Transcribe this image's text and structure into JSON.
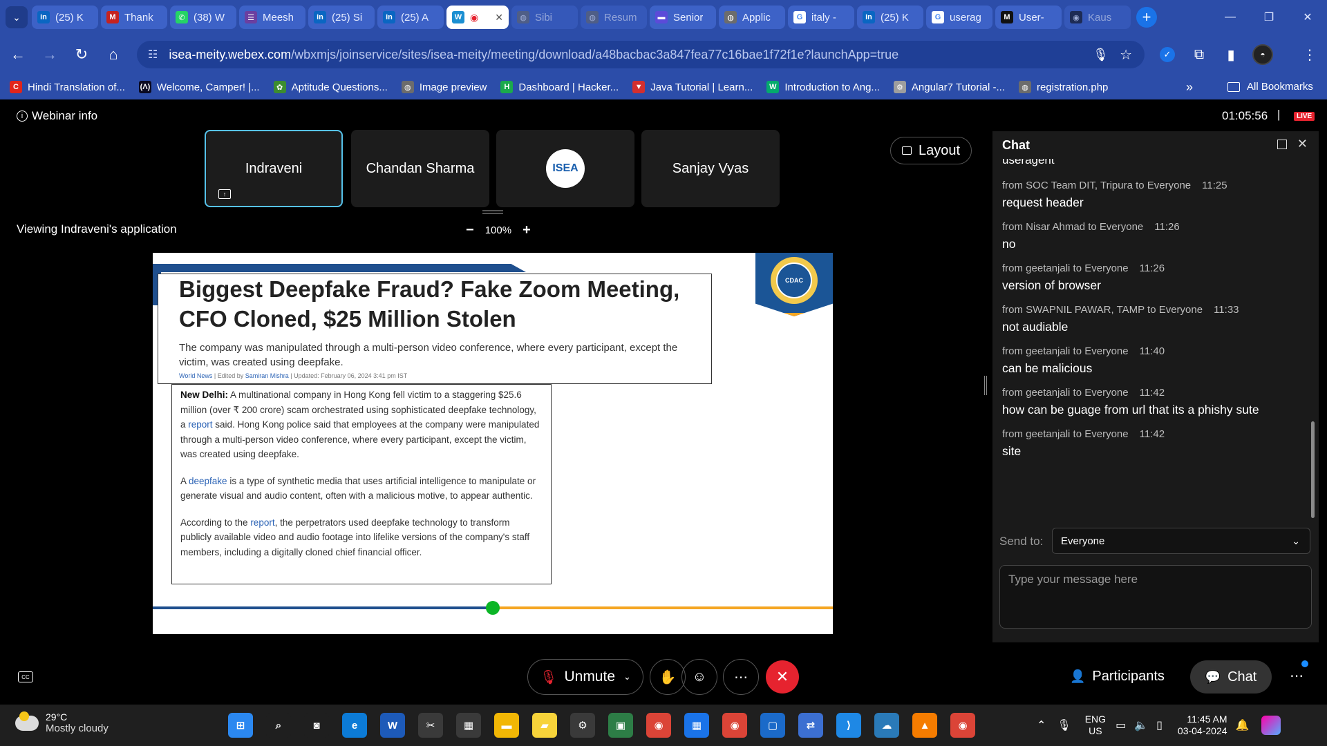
{
  "browser": {
    "tabs": [
      {
        "label": "(25) K",
        "icon": "linkedin-icon",
        "color": "#0a66c2",
        "glyph": "in"
      },
      {
        "label": "Thank",
        "icon": "gmail-icon",
        "color": "#c5221f",
        "glyph": "M"
      },
      {
        "label": "(38) W",
        "icon": "whatsapp-icon",
        "color": "#25d366",
        "glyph": "✆"
      },
      {
        "label": "Meesh",
        "icon": "forms-icon",
        "color": "#6b3fa0",
        "glyph": "☰"
      },
      {
        "label": "(25) Si",
        "icon": "linkedin-icon",
        "color": "#0a66c2",
        "glyph": "in"
      },
      {
        "label": "(25) A",
        "icon": "linkedin-icon",
        "color": "#0a66c2",
        "glyph": "in"
      },
      {
        "label": "",
        "icon": "webex-icon",
        "color": "#1b8fd2",
        "glyph": "W",
        "active": true
      },
      {
        "label": "Sibi",
        "icon": "globe-icon",
        "color": "#6c6c6c",
        "glyph": "◍",
        "dim": true
      },
      {
        "label": "Resum",
        "icon": "globe-icon",
        "color": "#6c6c6c",
        "glyph": "◍",
        "dim": true
      },
      {
        "label": "Senior",
        "icon": "job-icon",
        "color": "#5b4bd8",
        "glyph": "▬"
      },
      {
        "label": "Applic",
        "icon": "globe-icon",
        "color": "#6c6c6c",
        "glyph": "◍"
      },
      {
        "label": "italy -",
        "icon": "google-icon",
        "color": "#ffffff",
        "glyph": "G"
      },
      {
        "label": "(25) K",
        "icon": "linkedin-icon",
        "color": "#0a66c2",
        "glyph": "in"
      },
      {
        "label": "userag",
        "icon": "google-icon",
        "color": "#ffffff",
        "glyph": "G"
      },
      {
        "label": "User-",
        "icon": "medium-icon",
        "color": "#111111",
        "glyph": "M"
      },
      {
        "label": "Kaus",
        "icon": "github-icon",
        "color": "#111111",
        "glyph": "◉",
        "dim": true
      }
    ],
    "url_host": "isea-meity.webex.com",
    "url_path": "/wbxmjs/joinservice/sites/isea-meity/meeting/download/a48bacbac3a847fea77c16bae1f72f1e?launchApp=true",
    "bookmarks": [
      {
        "label": "Hindi Translation of...",
        "icon": "c-red-icon",
        "color": "#e1251b",
        "glyph": "C"
      },
      {
        "label": "Welcome, Camper! |...",
        "icon": "freecodecamp-icon",
        "color": "#0a0a23",
        "glyph": "(Λ)"
      },
      {
        "label": "Aptitude Questions...",
        "icon": "indiabix-icon",
        "color": "#3c8d2f",
        "glyph": "✿"
      },
      {
        "label": "Image preview",
        "icon": "globe-icon",
        "color": "#6c6c6c",
        "glyph": "◍"
      },
      {
        "label": "Dashboard | Hacker...",
        "icon": "hackerrank-icon",
        "color": "#1ba94c",
        "glyph": "H"
      },
      {
        "label": "Java Tutorial | Learn...",
        "icon": "javatpoint-icon",
        "color": "#d32f2f",
        "glyph": "▼"
      },
      {
        "label": "Introduction to Ang...",
        "icon": "w3schools-icon",
        "color": "#04aa6d",
        "glyph": "W"
      },
      {
        "label": "Angular7 Tutorial -...",
        "icon": "tutorialspoint-icon",
        "color": "#9e9e9e",
        "glyph": "⚙"
      },
      {
        "label": "registration.php",
        "icon": "globe-icon",
        "color": "#6c6c6c",
        "glyph": "◍"
      }
    ],
    "all_bookmarks": "All Bookmarks"
  },
  "meeting": {
    "webinar_info": "Webinar info",
    "timer": "01:05:56",
    "live": "LIVE",
    "participants": [
      "Indraveni",
      "Chandan Sharma",
      "",
      "Sanjay Vyas"
    ],
    "layout_label": "Layout",
    "viewing": "Viewing Indraveni's application",
    "zoom_minus": "−",
    "zoom_value": "100%",
    "zoom_plus": "+"
  },
  "slide": {
    "headline": "Biggest Deepfake Fraud? Fake Zoom Meeting, CFO Cloned, $25 Million Stolen",
    "subtitle": "The company was manipulated through a multi-person video conference, where every participant, except the victim, was created using deepfake.",
    "byline_section": "World News",
    "byline_sep1": " | Edited by ",
    "byline_author": "Samiran Mishra",
    "byline_sep2": " | Updated: February 06, 2024 3:41 pm IST",
    "p1_lead": "New Delhi:",
    "p1_a": " A multinational company in Hong Kong fell victim to a staggering  $25.6 million (over ₹ 200 crore) scam orchestrated using sophisticated deepfake technology, a ",
    "p1_link": "report",
    "p1_b": " said. Hong Kong police said that employees at the company were manipulated through a multi-person video conference, where every participant, except the victim, was created using deepfake.",
    "p2_a": "A ",
    "p2_link": "deepfake",
    "p2_b": " is a type of synthetic media that uses artificial intelligence to manipulate or generate visual and audio content, often with a malicious motive, to appear authentic.",
    "p3_a": "According to the ",
    "p3_link": "report",
    "p3_b": ", the perpetrators used deepfake technology to transform publicly available video and audio footage into lifelike versions of the company's staff members, including a digitally cloned chief financial officer.",
    "progress_fraction": 0.5
  },
  "chat": {
    "title": "Chat",
    "first_message": "useragent",
    "messages": [
      {
        "from": "from SOC Team DIT, Tripura to Everyone",
        "time": "11:25",
        "text": "request header"
      },
      {
        "from": "from Nisar Ahmad to Everyone",
        "time": "11:26",
        "text": "no"
      },
      {
        "from": "from geetanjali to Everyone",
        "time": "11:26",
        "text": "version of browser"
      },
      {
        "from": "from SWAPNIL PAWAR, TAMP to Everyone",
        "time": "11:33",
        "text": "not audiable"
      },
      {
        "from": "from geetanjali to Everyone",
        "time": "11:40",
        "text": "can be malicious"
      },
      {
        "from": "from geetanjali to Everyone",
        "time": "11:42",
        "text": "how can be guage from url that its a phishy sute"
      },
      {
        "from": "from geetanjali to Everyone",
        "time": "11:42",
        "text": "site"
      }
    ],
    "send_to_label": "Send to:",
    "send_to_value": "Everyone",
    "input_placeholder": "Type your message here"
  },
  "controls": {
    "unmute": "Unmute",
    "participants": "Participants",
    "chat": "Chat"
  },
  "taskbar": {
    "temperature": "29°C",
    "weather": "Mostly cloudy",
    "lang_1": "ENG",
    "lang_2": "US",
    "time": "11:45 AM",
    "date": "03-04-2024",
    "apps": [
      {
        "icon": "windows-start-icon",
        "color": "#2b88f0",
        "glyph": "⊞"
      },
      {
        "icon": "search-icon",
        "color": "#1f1f1f",
        "glyph": "⌕"
      },
      {
        "icon": "camera-icon",
        "color": "#1f1f1f",
        "glyph": "◙"
      },
      {
        "icon": "edge-icon",
        "color": "#0c7bd6",
        "glyph": "e"
      },
      {
        "icon": "word-icon",
        "color": "#1d5ab8",
        "glyph": "W"
      },
      {
        "icon": "snipping-tool-icon",
        "color": "#3a3a3a",
        "glyph": "✂"
      },
      {
        "icon": "ms-store-icon",
        "color": "#3a3a3a",
        "glyph": "▦"
      },
      {
        "icon": "file-explorer-icon",
        "color": "#f2b705",
        "glyph": "▬"
      },
      {
        "icon": "sticky-notes-icon",
        "color": "#f7d33a",
        "glyph": "▰"
      },
      {
        "icon": "settings-icon",
        "color": "#3a3a3a",
        "glyph": "⚙"
      },
      {
        "icon": "photos-icon",
        "color": "#2d7d46",
        "glyph": "▣"
      },
      {
        "icon": "chrome-icon",
        "color": "#db4437",
        "glyph": "◉"
      },
      {
        "icon": "calendar-icon",
        "color": "#1a73e8",
        "glyph": "▦"
      },
      {
        "icon": "chrome-icon",
        "color": "#db4437",
        "glyph": "◉"
      },
      {
        "icon": "virtualbox-icon",
        "color": "#1b6ac9",
        "glyph": "▢"
      },
      {
        "icon": "network-tool-icon",
        "color": "#3c6fd1",
        "glyph": "⇄"
      },
      {
        "icon": "vscode-icon",
        "color": "#1e88e5",
        "glyph": "⟩"
      },
      {
        "icon": "cloud-app-icon",
        "color": "#2a7ab8",
        "glyph": "☁"
      },
      {
        "icon": "orange-app-icon",
        "color": "#f57c00",
        "glyph": "▲"
      },
      {
        "icon": "chrome-icon",
        "color": "#db4437",
        "glyph": "◉"
      }
    ]
  }
}
